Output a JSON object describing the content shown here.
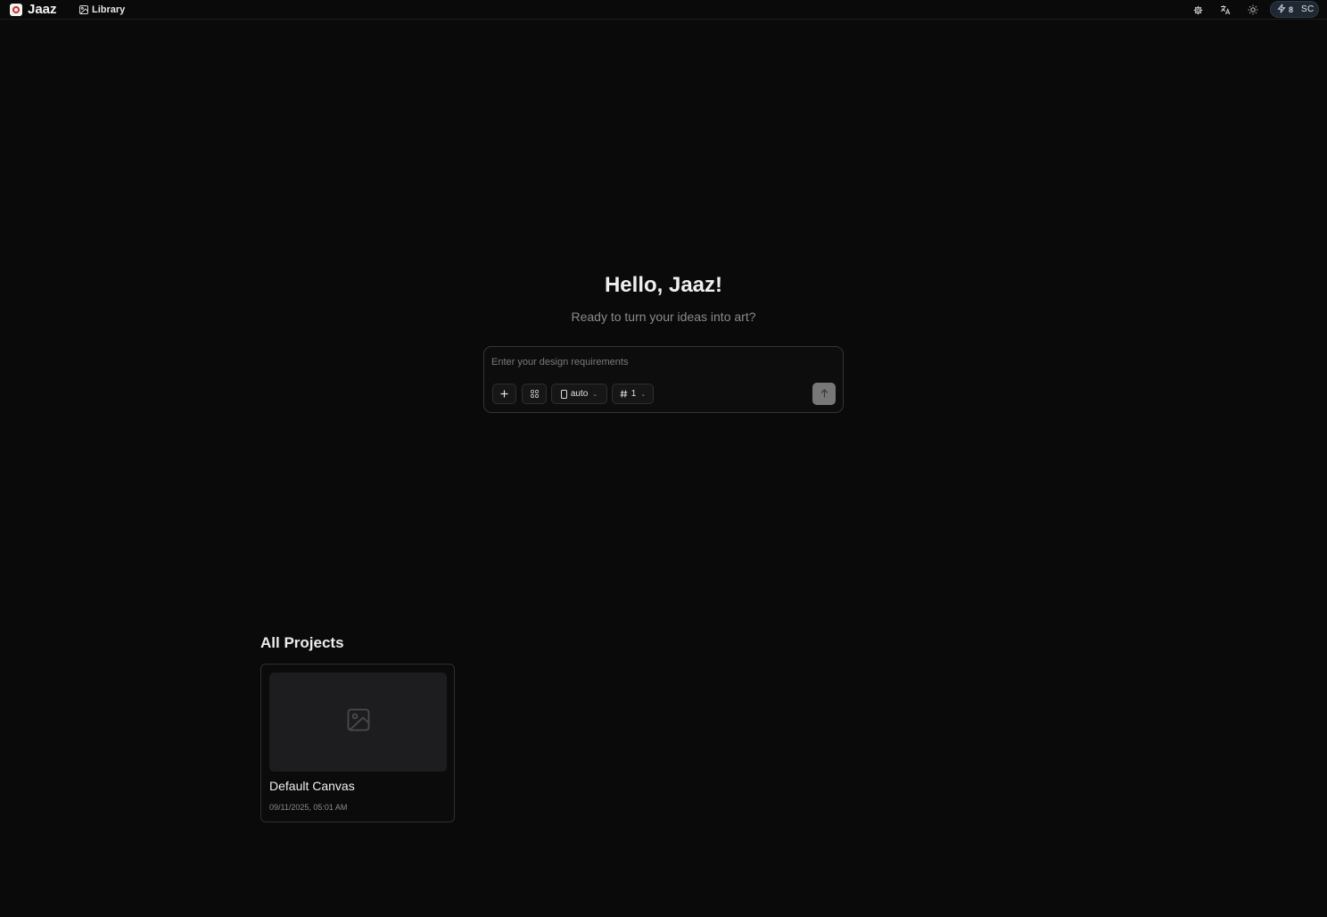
{
  "app": {
    "name": "Jaaz"
  },
  "nav": {
    "library_label": "Library"
  },
  "header": {
    "icons": [
      "settings-icon",
      "translate-icon",
      "theme-sun-icon"
    ],
    "credits": "8",
    "avatar_initials": "SC"
  },
  "hero": {
    "title": "Hello, Jaaz!",
    "subtitle": "Ready to turn your ideas into art?"
  },
  "prompt": {
    "placeholder": "Enter your design requirements",
    "value": "",
    "aspect_ratio": "auto",
    "count": "1"
  },
  "projects": {
    "heading": "All Projects",
    "items": [
      {
        "name": "Default Canvas",
        "date": "09/11/2025, 05:01 AM"
      }
    ]
  },
  "colors": {
    "background": "#0a0a0a",
    "credits_pill": "#1f2833",
    "send_button": "#777777",
    "brand_logo_accent": "#c8322d"
  }
}
